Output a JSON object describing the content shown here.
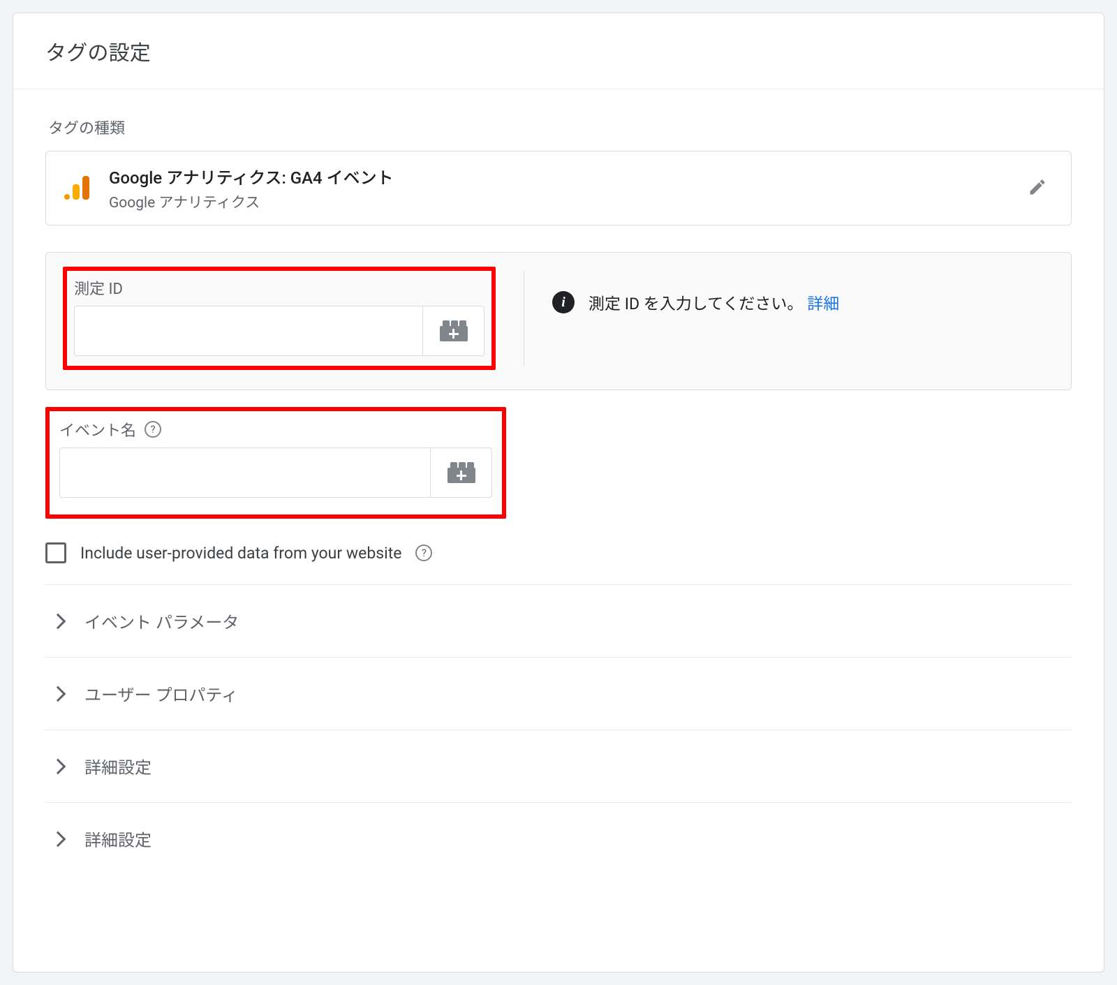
{
  "header": {
    "title": "タグの設定"
  },
  "tag_type": {
    "section_label": "タグの種類",
    "title": "Google アナリティクス: GA4 イベント",
    "subtitle": "Google アナリティクス"
  },
  "measurement": {
    "label": "測定 ID",
    "value": "",
    "info_text": "測定 ID を入力してください。",
    "info_link": "詳細"
  },
  "event": {
    "label": "イベント名",
    "value": ""
  },
  "checkbox": {
    "label": "Include user-provided data from your website"
  },
  "expanders": [
    {
      "label": "イベント パラメータ"
    },
    {
      "label": "ユーザー プロパティ"
    },
    {
      "label": "詳細設定"
    },
    {
      "label": "詳細設定"
    }
  ]
}
